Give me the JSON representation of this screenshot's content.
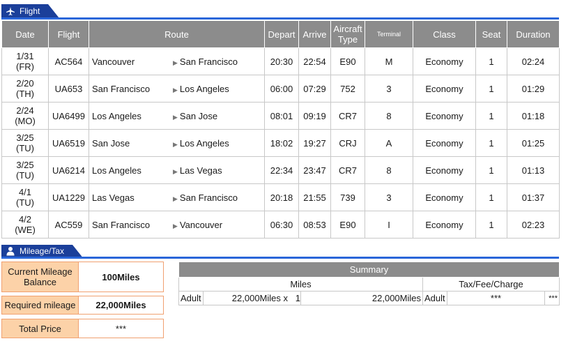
{
  "flight_section": {
    "title": "Flight",
    "icon": "airplane-icon"
  },
  "table": {
    "headers": {
      "date": "Date",
      "flight": "Flight",
      "route": "Route",
      "depart": "Depart",
      "arrive": "Arrive",
      "aircraft": "Aircraft Type",
      "terminal": "Terminal",
      "class": "Class",
      "seat": "Seat",
      "duration": "Duration"
    },
    "rows": [
      {
        "date": "1/31",
        "day": "(FR)",
        "flight": "AC564",
        "from": "Vancouver",
        "to": "San Francisco",
        "depart": "20:30",
        "arrive": "22:54",
        "aircraft": "E90",
        "terminal": "M",
        "class": "Economy",
        "seat": "1",
        "duration": "02:24"
      },
      {
        "date": "2/20",
        "day": "(TH)",
        "flight": "UA653",
        "from": "San Francisco",
        "to": "Los Angeles",
        "depart": "06:00",
        "arrive": "07:29",
        "aircraft": "752",
        "terminal": "3",
        "class": "Economy",
        "seat": "1",
        "duration": "01:29"
      },
      {
        "date": "2/24",
        "day": "(MO)",
        "flight": "UA6499",
        "from": "Los Angeles",
        "to": "San Jose",
        "depart": "08:01",
        "arrive": "09:19",
        "aircraft": "CR7",
        "terminal": "8",
        "class": "Economy",
        "seat": "1",
        "duration": "01:18"
      },
      {
        "date": "3/25",
        "day": "(TU)",
        "flight": "UA6519",
        "from": "San Jose",
        "to": "Los Angeles",
        "depart": "18:02",
        "arrive": "19:27",
        "aircraft": "CRJ",
        "terminal": "A",
        "class": "Economy",
        "seat": "1",
        "duration": "01:25"
      },
      {
        "date": "3/25",
        "day": "(TU)",
        "flight": "UA6214",
        "from": "Los Angeles",
        "to": "Las Vegas",
        "depart": "22:34",
        "arrive": "23:47",
        "aircraft": "CR7",
        "terminal": "8",
        "class": "Economy",
        "seat": "1",
        "duration": "01:13"
      },
      {
        "date": "4/1",
        "day": "(TU)",
        "flight": "UA1229",
        "from": "Las Vegas",
        "to": "San Francisco",
        "depart": "20:18",
        "arrive": "21:55",
        "aircraft": "739",
        "terminal": "3",
        "class": "Economy",
        "seat": "1",
        "duration": "01:37"
      },
      {
        "date": "4/2",
        "day": "(WE)",
        "flight": "AC559",
        "from": "San Francisco",
        "to": "Vancouver",
        "depart": "06:30",
        "arrive": "08:53",
        "aircraft": "E90",
        "terminal": "I",
        "class": "Economy",
        "seat": "1",
        "duration": "02:23"
      }
    ]
  },
  "mileage_section": {
    "title": "Mileage/Tax",
    "icon": "person-icon"
  },
  "mileage": {
    "current_label": "Current Mileage Balance",
    "current_value": "100Miles",
    "required_label": "Required mileage",
    "required_value": "22,000Miles",
    "total_label": "Total Price",
    "total_value": "***"
  },
  "summary": {
    "title": "Summary",
    "miles_header": "Miles",
    "tax_header": "Tax/Fee/Charge",
    "adult_label": "Adult",
    "miles_per": "22,000Miles x",
    "count": "1",
    "miles_total": "22,000Miles",
    "tax_adult_label": "Adult",
    "tax_value": "***",
    "tax_total": "***"
  },
  "colors": {
    "header_bar": "#1b3f9a",
    "header_line": "#2a66d9",
    "table_header": "#8c8c8c",
    "mileage_label_bg": "#fcd2a8",
    "mileage_border": "#f0a070"
  }
}
